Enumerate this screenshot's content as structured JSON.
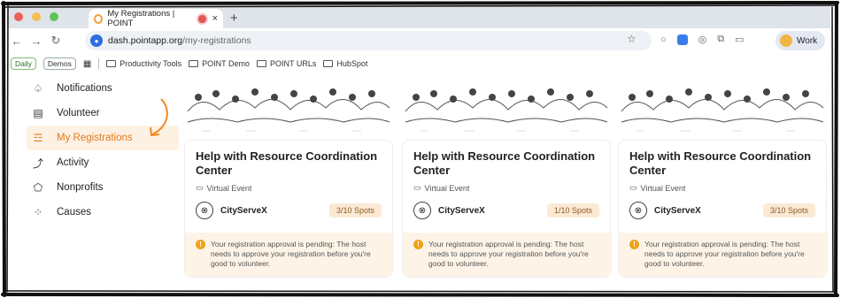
{
  "browser": {
    "tab_title": "My Registrations | POINT",
    "new_tab": "+",
    "url_host": "dash.pointapp.org",
    "url_path": "/my-registrations",
    "profile_label": "Work"
  },
  "bookmarks": {
    "chips": [
      "Daily",
      "Demos"
    ],
    "items": [
      "Productivity Tools",
      "POINT Demo",
      "POINT URLs",
      "HubSpot"
    ]
  },
  "sidebar": {
    "items": [
      {
        "label": "Notifications",
        "icon": "bell-icon"
      },
      {
        "label": "Volunteer",
        "icon": "calendar-icon"
      },
      {
        "label": "My Registrations",
        "icon": "registrations-icon",
        "active": true
      },
      {
        "label": "Activity",
        "icon": "activity-icon"
      },
      {
        "label": "Nonprofits",
        "icon": "nonprofit-icon"
      },
      {
        "label": "Causes",
        "icon": "causes-icon"
      }
    ]
  },
  "cards": [
    {
      "title": "Help with Resource Coordination Center",
      "event_type": "Virtual Event",
      "org": "CityServeX",
      "spots": "3/10 Spots",
      "notice": "Your registration approval is pending: The host needs to approve your registration before you're good to volunteer."
    },
    {
      "title": "Help with Resource Coordination Center",
      "event_type": "Virtual Event",
      "org": "CityServeX",
      "spots": "1/10 Spots",
      "notice": "Your registration approval is pending: The host needs to approve your registration before you're good to volunteer."
    },
    {
      "title": "Help with Resource Coordination Center",
      "event_type": "Virtual Event",
      "org": "CityServeX",
      "spots": "3/10 Spots",
      "notice": "Your registration approval is pending: The host needs to approve your registration before you're good to volunteer."
    }
  ],
  "colors": {
    "accent": "#e07b1e",
    "active_bg": "#fdf1e3",
    "notice_bg": "#fdf4e7"
  }
}
